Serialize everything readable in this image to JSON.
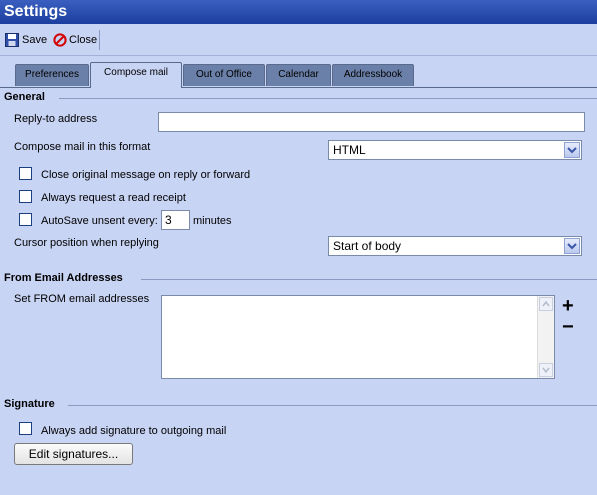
{
  "window": {
    "title": "Settings"
  },
  "toolbar": {
    "save_label": "Save",
    "close_label": "Close"
  },
  "tabs": [
    {
      "label": "Preferences"
    },
    {
      "label": "Compose mail"
    },
    {
      "label": "Out of Office"
    },
    {
      "label": "Calendar"
    },
    {
      "label": "Addressbook"
    }
  ],
  "general": {
    "heading": "General",
    "reply_to_label": "Reply-to address",
    "reply_to_value": "",
    "compose_format_label": "Compose mail in this format",
    "compose_format_value": "HTML",
    "close_original_label": "Close original message on reply or forward",
    "read_receipt_label": "Always request a read receipt",
    "autosave_label": "AutoSave unsent every:",
    "autosave_value": "3",
    "autosave_unit": "minutes",
    "cursor_position_label": "Cursor position when replying",
    "cursor_position_value": "Start of body"
  },
  "from_addresses": {
    "heading": "From Email Addresses",
    "set_from_label": "Set FROM email addresses",
    "add_symbol": "+",
    "remove_symbol": "−"
  },
  "signature": {
    "heading": "Signature",
    "always_add_label": "Always add signature to outgoing mail",
    "edit_button": "Edit signatures..."
  },
  "colors": {
    "titlebar": "#1c3f9f",
    "background": "#c8d4f4",
    "inactive_tab": "#6b80a8"
  }
}
